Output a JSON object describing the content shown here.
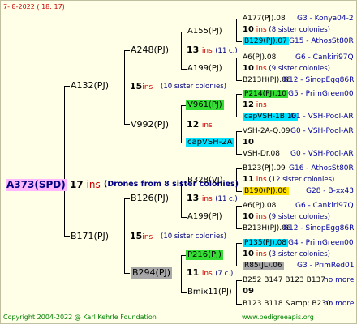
{
  "header": {
    "date": "7-  8-2022 ( 18:  17)"
  },
  "root": {
    "name": "A373(SPD)",
    "num": "17",
    "ins": "ins",
    "note": "(Drones from 8 sister colonies)"
  },
  "gen1": [
    {
      "name": "A132(PJ)",
      "num": "15",
      "ins": "ins",
      "note": "(10 sister colonies)"
    },
    {
      "name": "B171(PJ)",
      "num": "15",
      "ins": "ins",
      "note": "(10 sister colonies)"
    }
  ],
  "gen2": [
    {
      "name": "A248(PJ)",
      "num": "13",
      "ins": "ins",
      "note": "(11 c.)"
    },
    {
      "name": "V992(PJ)",
      "num": "12",
      "ins": "ins",
      "note": ""
    },
    {
      "name": "B126(PJ)",
      "num": "13",
      "ins": "ins",
      "note": "(11 c.)"
    },
    {
      "name": "B294(PJ)",
      "num": "11",
      "ins": "ins",
      "note": "(7 c.)"
    }
  ],
  "gen3": [
    {
      "name": "A155(PJ)"
    },
    {
      "name": "A199(PJ)"
    },
    {
      "name": "V961(PJ)"
    },
    {
      "name": "capVSH-2A"
    },
    {
      "name": "B328(VJ)"
    },
    {
      "name": "A199(PJ)"
    },
    {
      "name": "P216(PJ)"
    },
    {
      "name": "Bmix11(PJ)"
    }
  ],
  "gen4": [
    {
      "name": "A177(PJ).08",
      "info": "G3 - Konya04-2"
    },
    {
      "name": "10",
      "ins": "ins",
      "note": "(8 sister colonies)"
    },
    {
      "name": "B129(PJ).07",
      "info": "G15 - AthosSt80R"
    },
    {
      "name": "A6(PJ).08",
      "info": "G6 - Cankiri97Q"
    },
    {
      "name": "10",
      "ins": "ins",
      "note": "(9 sister colonies)"
    },
    {
      "name": "B213H(PJ).06",
      "info": "G12 - SinopEgg86R"
    },
    {
      "name": "P214(PJ).10",
      "info": "G5 - PrimGreen00"
    },
    {
      "name": "12",
      "ins": "ins",
      "note": ""
    },
    {
      "name": "capVSH-1B.10",
      "info": "G1 - VSH-Pool-AR"
    },
    {
      "name": "VSH-2A-Q.09",
      "info": "G0 - VSH-Pool-AR"
    },
    {
      "name": "10",
      "ins": "",
      "note": ""
    },
    {
      "name": "VSH-Dr.08",
      "info": "G0 - VSH-Pool-AR"
    },
    {
      "name": "B123(PJ).09",
      "info": "G16 - AthosSt80R"
    },
    {
      "name": "11",
      "ins": "ins",
      "note": "(12 sister colonies)"
    },
    {
      "name": "B190(PJ).06",
      "info": "G28 - B-xx43"
    },
    {
      "name": "A6(PJ).08",
      "info": "G6 - Cankiri97Q"
    },
    {
      "name": "10",
      "ins": "ins",
      "note": "(9 sister colonies)"
    },
    {
      "name": "B213H(PJ).06",
      "info": "G12 - SinopEgg86R"
    },
    {
      "name": "P135(PJ).08",
      "info": "G4 - PrimGreen00"
    },
    {
      "name": "10",
      "ins": "ins",
      "note": "(3 sister colonies)"
    },
    {
      "name": "R85(JL).06",
      "info": "G3 - PrimRed01"
    },
    {
      "name": "B252 B147 B123 B137",
      "info": "no more"
    },
    {
      "name": "09",
      "ins": "",
      "note": ""
    },
    {
      "name": "B123 B118 &amp; B230",
      "info": "no more"
    }
  ],
  "footer": {
    "copyright": "Copyright 2004-2022 @ Karl Kehrle Foundation",
    "url": "www.pedigreeapis.org"
  }
}
